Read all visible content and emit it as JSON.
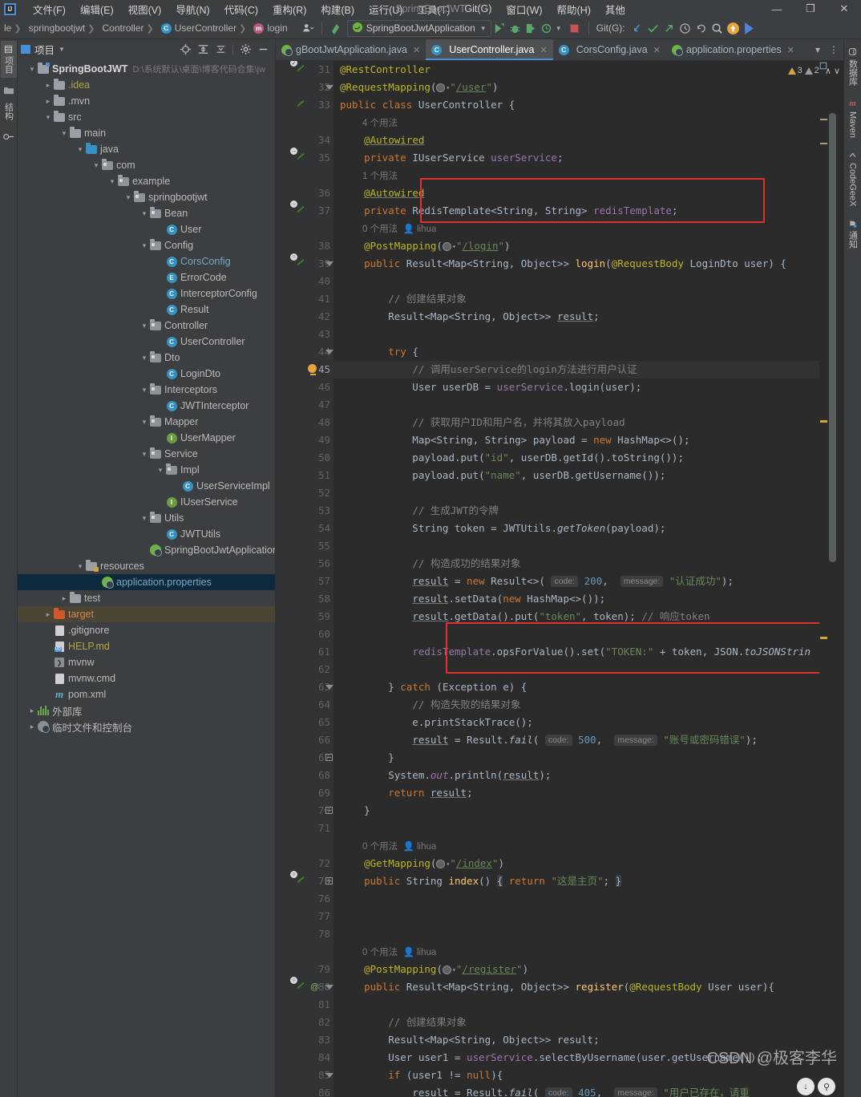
{
  "window": {
    "title": "SpringBootJWT",
    "minimize": "—",
    "maximize": "❐",
    "close": "✕"
  },
  "menu": {
    "items": [
      "文件(F)",
      "编辑(E)",
      "视图(V)",
      "导航(N)",
      "代码(C)",
      "重构(R)",
      "构建(B)",
      "运行(U)",
      "工具(T)",
      "Git(G)",
      "窗口(W)",
      "帮助(H)",
      "其他"
    ],
    "logo": "IJ"
  },
  "navbar": {
    "crumbs": [
      "le",
      "springbootjwt",
      "Controller",
      "UserController",
      "login"
    ],
    "crumb_badges": [
      "",
      "",
      "",
      "C",
      "m"
    ],
    "run_config": "SpringBootJwtApplication",
    "git_label": "Git(G):",
    "icons": [
      "run-icon",
      "debug-icon",
      "run-coverage-icon",
      "profile-icon",
      "stop-icon",
      "git-update-icon",
      "git-commit-icon",
      "git-push-icon",
      "git-history-icon",
      "git-rollback-icon",
      "search-everywhere-icon",
      "updates-icon",
      "ai-assistant-icon"
    ]
  },
  "left_strip": {
    "project_tab": "项目",
    "structure_tab": "结构",
    "bookmark_icon": "bookmarks-icon",
    "commit_icon": "commit-icon"
  },
  "right_strip": {
    "items": [
      "数据库",
      "Maven",
      "CodeGeeX",
      "通知"
    ]
  },
  "project": {
    "title": "项目",
    "toolbar": [
      "locate-icon",
      "expand-all-icon",
      "collapse-all-icon",
      "settings-icon",
      "hide-icon"
    ],
    "root": {
      "label": "SpringBootJWT",
      "path": "D:\\系统默认\\桌面\\博客代码合集\\jw"
    },
    "nodes": [
      {
        "label": ".idea",
        "indent": 1,
        "arrow": "›",
        "icon": "folder",
        "color": "yellow"
      },
      {
        "label": ".mvn",
        "indent": 1,
        "arrow": "›",
        "icon": "folder",
        "color": ""
      },
      {
        "label": "src",
        "indent": 1,
        "arrow": "∨",
        "icon": "folder",
        "color": ""
      },
      {
        "label": "main",
        "indent": 2,
        "arrow": "∨",
        "icon": "folder",
        "color": ""
      },
      {
        "label": "java",
        "indent": 3,
        "arrow": "∨",
        "icon": "folder-java",
        "color": ""
      },
      {
        "label": "com",
        "indent": 4,
        "arrow": "∨",
        "icon": "folder-pkg",
        "color": ""
      },
      {
        "label": "example",
        "indent": 5,
        "arrow": "∨",
        "icon": "folder-pkg",
        "color": ""
      },
      {
        "label": "springbootjwt",
        "indent": 6,
        "arrow": "∨",
        "icon": "folder-pkg",
        "color": ""
      },
      {
        "label": "Bean",
        "indent": 7,
        "arrow": "∨",
        "icon": "folder-pkg",
        "color": ""
      },
      {
        "label": "User",
        "indent": 8,
        "arrow": "",
        "icon": "class",
        "color": ""
      },
      {
        "label": "Config",
        "indent": 7,
        "arrow": "∨",
        "icon": "folder-pkg",
        "color": ""
      },
      {
        "label": "CorsConfig",
        "indent": 8,
        "arrow": "",
        "icon": "class",
        "color": "blue"
      },
      {
        "label": "ErrorCode",
        "indent": 8,
        "arrow": "",
        "icon": "enum",
        "color": ""
      },
      {
        "label": "InterceptorConfig",
        "indent": 8,
        "arrow": "",
        "icon": "class",
        "color": ""
      },
      {
        "label": "Result",
        "indent": 8,
        "arrow": "",
        "icon": "class",
        "color": ""
      },
      {
        "label": "Controller",
        "indent": 7,
        "arrow": "∨",
        "icon": "folder-pkg",
        "color": ""
      },
      {
        "label": "UserController",
        "indent": 8,
        "arrow": "",
        "icon": "class",
        "color": ""
      },
      {
        "label": "Dto",
        "indent": 7,
        "arrow": "∨",
        "icon": "folder-pkg",
        "color": ""
      },
      {
        "label": "LoginDto",
        "indent": 8,
        "arrow": "",
        "icon": "class",
        "color": ""
      },
      {
        "label": "Interceptors",
        "indent": 7,
        "arrow": "∨",
        "icon": "folder-pkg",
        "color": ""
      },
      {
        "label": "JWTInterceptor",
        "indent": 8,
        "arrow": "",
        "icon": "class",
        "color": ""
      },
      {
        "label": "Mapper",
        "indent": 7,
        "arrow": "∨",
        "icon": "folder-pkg",
        "color": ""
      },
      {
        "label": "UserMapper",
        "indent": 8,
        "arrow": "",
        "icon": "interface",
        "color": ""
      },
      {
        "label": "Service",
        "indent": 7,
        "arrow": "∨",
        "icon": "folder-pkg",
        "color": ""
      },
      {
        "label": "Impl",
        "indent": 8,
        "arrow": "∨",
        "icon": "folder-pkg",
        "color": ""
      },
      {
        "label": "UserServiceImpl",
        "indent": 9,
        "arrow": "",
        "icon": "class",
        "color": ""
      },
      {
        "label": "IUserService",
        "indent": 8,
        "arrow": "",
        "icon": "interface",
        "color": ""
      },
      {
        "label": "Utils",
        "indent": 7,
        "arrow": "∨",
        "icon": "folder-pkg",
        "color": ""
      },
      {
        "label": "JWTUtils",
        "indent": 8,
        "arrow": "",
        "icon": "class",
        "color": ""
      },
      {
        "label": "SpringBootJwtApplication",
        "indent": 7,
        "arrow": "",
        "icon": "spring",
        "color": ""
      },
      {
        "label": "resources",
        "indent": 3,
        "arrow": "∨",
        "icon": "folder-res",
        "color": ""
      },
      {
        "label": "application.properties",
        "indent": 4,
        "arrow": "",
        "icon": "spring-prop",
        "color": "blue",
        "state": "selected"
      },
      {
        "label": "test",
        "indent": 2,
        "arrow": "›",
        "icon": "folder",
        "color": ""
      },
      {
        "label": "target",
        "indent": 1,
        "arrow": "›",
        "icon": "folder-red",
        "color": "orange",
        "state": "target"
      },
      {
        "label": ".gitignore",
        "indent": 1,
        "arrow": "",
        "icon": "file-ignore",
        "color": ""
      },
      {
        "label": "HELP.md",
        "indent": 1,
        "arrow": "",
        "icon": "file-md",
        "color": "yellow"
      },
      {
        "label": "mvnw",
        "indent": 1,
        "arrow": "",
        "icon": "file-sh",
        "color": ""
      },
      {
        "label": "mvnw.cmd",
        "indent": 1,
        "arrow": "",
        "icon": "file-cmd",
        "color": ""
      },
      {
        "label": "pom.xml",
        "indent": 1,
        "arrow": "",
        "icon": "file-maven",
        "color": ""
      },
      {
        "label": "外部库",
        "indent": 0,
        "arrow": "›",
        "icon": "libraries",
        "color": ""
      },
      {
        "label": "临时文件和控制台",
        "indent": 0,
        "arrow": "›",
        "icon": "scratches",
        "color": ""
      }
    ]
  },
  "tabs": {
    "items": [
      {
        "label": "gBootJwtApplication.java",
        "icon": "spring-class",
        "active": false
      },
      {
        "label": "UserController.java",
        "icon": "class",
        "active": true
      },
      {
        "label": "CorsConfig.java",
        "icon": "class",
        "active": false
      },
      {
        "label": "application.properties",
        "icon": "spring-prop",
        "active": false
      }
    ],
    "close_glyph": "✕"
  },
  "inspection": {
    "warnings": "3",
    "weak_warnings": "2",
    "up": "∧",
    "down": "∨"
  },
  "editor": {
    "file": "UserController.java",
    "first_line": 31,
    "line_numbers": [
      31,
      32,
      33,
      "",
      34,
      35,
      "",
      36,
      37,
      "",
      38,
      39,
      40,
      41,
      42,
      43,
      44,
      45,
      46,
      47,
      48,
      49,
      50,
      51,
      52,
      53,
      54,
      55,
      56,
      57,
      58,
      59,
      60,
      61,
      62,
      63,
      64,
      65,
      66,
      67,
      68,
      69,
      70,
      71,
      "",
      72,
      73,
      76,
      77,
      78,
      "",
      79,
      80,
      81,
      82,
      83,
      84,
      85,
      86
    ],
    "current_line": 45,
    "usage_labels": [
      "4 个用法",
      "1 个用法",
      "0 个用法",
      "0 个用法",
      "0 个用法"
    ],
    "author": "lihua",
    "inlay_code": "code:",
    "inlay_message": "message:",
    "code_lines": [
      "@RestController",
      "@RequestMapping(\"/user\")",
      "public class UserController {",
      "    @Autowired",
      "    private IUserService userService;",
      "    @Autowired",
      "    private RedisTemplate<String, String> redisTemplate;",
      "    @PostMapping(\"/login\")",
      "    public Result<Map<String, Object>> login(@RequestBody LoginDto user) {",
      "        // 创建结果对象",
      "        Result<Map<String, Object>> result;",
      "        try {",
      "            // 调用userService的login方法进行用户认证",
      "            User userDB = userService.login(user);",
      "            // 获取用户ID和用户名，并将其放入payload",
      "            Map<String, String> payload = new HashMap<>();",
      "            payload.put(\"id\", userDB.getId().toString());",
      "            payload.put(\"name\", userDB.getUsername());",
      "            // 生成JWT的令牌",
      "            String token = JWTUtils.getToken(payload);",
      "            // 构造成功的结果对象",
      "            result = new Result<>( code: 200,  message: \"认证成功\");",
      "            result.setData(new HashMap<>());",
      "            result.getData().put(\"token\", token); // 响应token",
      "            redisTemplate.opsForValue().set(\"TOKEN:\" + token, JSON.toJSONStrin",
      "        } catch (Exception e) {",
      "            // 构造失败的结果对象",
      "            e.printStackTrace();",
      "            result = Result.fail( code: 500,  message: \"账号或密码错误\");",
      "        }",
      "        System.out.println(result);",
      "        return result;",
      "    }",
      "    @GetMapping(\"/index\")",
      "    public String index() { return \"这是主页\"; }",
      "    @PostMapping(\"/register\")",
      "    public Result<Map<String, Object>> register(@RequestBody User user){",
      "        // 创建结果对象",
      "        Result<Map<String, Object>> result;",
      "        User user1 = userService.selectByUsername(user.getUsername());",
      "        if (user1 != null){",
      "            result = Result.fail( code: 405,  message: \"用户已存在，请重"
    ],
    "annotations": [
      {
        "name": "redis-template-field-box",
        "color": "#e03030"
      },
      {
        "name": "redis-set-token-box",
        "color": "#e03030"
      }
    ]
  },
  "watermark": {
    "text": "CSDN @极客李华"
  },
  "colors": {
    "accent": "#4a90d9",
    "editor_bg": "#2b2b2b",
    "panel_bg": "#3c3f41",
    "gutter_bg": "#313335",
    "selection": "#0d293e",
    "annotation_red": "#e03030",
    "spring_green": "#6db33f",
    "keyword": "#cc7832",
    "string": "#6a8759",
    "number": "#6897bb",
    "comment": "#808080",
    "annotation_yellow": "#bbb529",
    "field": "#9876aa",
    "method": "#ffc66d"
  }
}
